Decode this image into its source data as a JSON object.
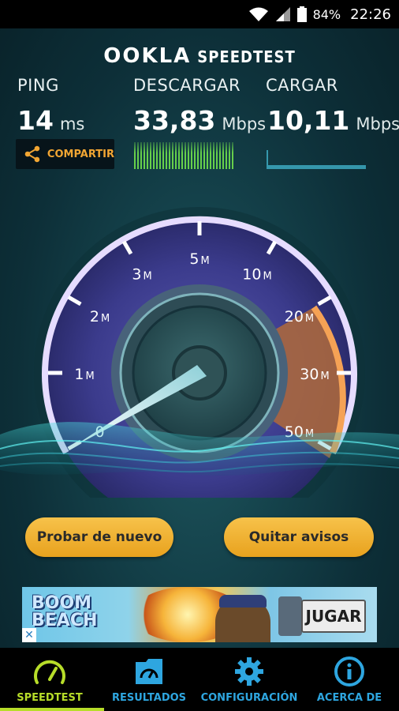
{
  "status_bar": {
    "battery_percent": "84%",
    "time": "22:26"
  },
  "header": {
    "brand": "OOKLA",
    "product": "SPEEDTEST"
  },
  "metrics": {
    "ping": {
      "label": "PING",
      "value": "14",
      "unit": "ms"
    },
    "download": {
      "label": "DESCARGAR",
      "value": "33,83",
      "unit": "Mbps"
    },
    "upload": {
      "label": "CARGAR",
      "value": "10,11",
      "unit": "Mbps"
    }
  },
  "share_button": {
    "label": "COMPARTIR",
    "icon": "share-icon"
  },
  "gauge": {
    "ticks": [
      {
        "num": "0",
        "unit": ""
      },
      {
        "num": "1",
        "unit": "M"
      },
      {
        "num": "2",
        "unit": "M"
      },
      {
        "num": "3",
        "unit": "M"
      },
      {
        "num": "5",
        "unit": "M"
      },
      {
        "num": "10",
        "unit": "M"
      },
      {
        "num": "20",
        "unit": "M"
      },
      {
        "num": "30",
        "unit": "M"
      },
      {
        "num": "50",
        "unit": "M"
      }
    ],
    "needle_value": "0",
    "accent_color": "#e08a3a",
    "arc_color": "#c9a8ff"
  },
  "actions": {
    "retry": "Probar de nuevo",
    "remove_ads": "Quitar avisos"
  },
  "ad": {
    "title_line1": "BOOM",
    "title_line2": "BEACH",
    "cta": "JUGAR",
    "close": "✕"
  },
  "nav": {
    "items": [
      {
        "label": "SPEEDTEST",
        "icon": "speedometer-icon",
        "active": true
      },
      {
        "label": "RESULTADOS",
        "icon": "folder-icon",
        "active": false
      },
      {
        "label": "CONFIGURACIÓN",
        "icon": "gear-icon",
        "active": false
      },
      {
        "label": "ACERCA DE",
        "icon": "info-icon",
        "active": false
      }
    ],
    "active_color": "#b7dd29",
    "inactive_color": "#2ea6e0"
  }
}
